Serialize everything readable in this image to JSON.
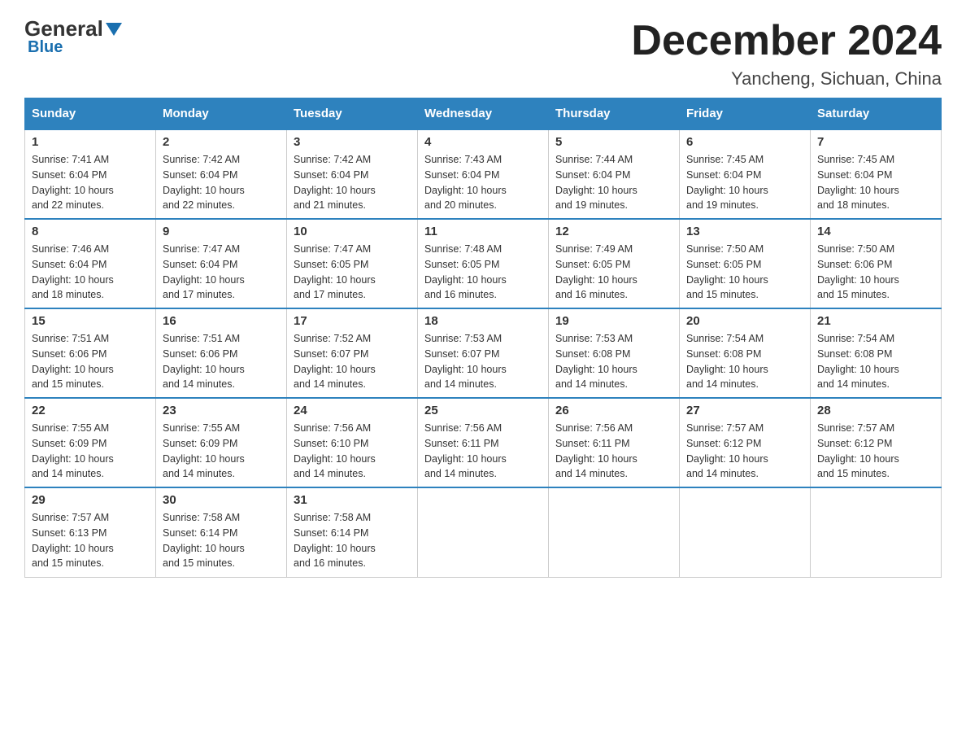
{
  "logo": {
    "general": "General",
    "blue": "Blue"
  },
  "header": {
    "month": "December 2024",
    "location": "Yancheng, Sichuan, China"
  },
  "days_of_week": [
    "Sunday",
    "Monday",
    "Tuesday",
    "Wednesday",
    "Thursday",
    "Friday",
    "Saturday"
  ],
  "weeks": [
    [
      {
        "day": "1",
        "sunrise": "7:41 AM",
        "sunset": "6:04 PM",
        "daylight": "10 hours and 22 minutes."
      },
      {
        "day": "2",
        "sunrise": "7:42 AM",
        "sunset": "6:04 PM",
        "daylight": "10 hours and 22 minutes."
      },
      {
        "day": "3",
        "sunrise": "7:42 AM",
        "sunset": "6:04 PM",
        "daylight": "10 hours and 21 minutes."
      },
      {
        "day": "4",
        "sunrise": "7:43 AM",
        "sunset": "6:04 PM",
        "daylight": "10 hours and 20 minutes."
      },
      {
        "day": "5",
        "sunrise": "7:44 AM",
        "sunset": "6:04 PM",
        "daylight": "10 hours and 19 minutes."
      },
      {
        "day": "6",
        "sunrise": "7:45 AM",
        "sunset": "6:04 PM",
        "daylight": "10 hours and 19 minutes."
      },
      {
        "day": "7",
        "sunrise": "7:45 AM",
        "sunset": "6:04 PM",
        "daylight": "10 hours and 18 minutes."
      }
    ],
    [
      {
        "day": "8",
        "sunrise": "7:46 AM",
        "sunset": "6:04 PM",
        "daylight": "10 hours and 18 minutes."
      },
      {
        "day": "9",
        "sunrise": "7:47 AM",
        "sunset": "6:04 PM",
        "daylight": "10 hours and 17 minutes."
      },
      {
        "day": "10",
        "sunrise": "7:47 AM",
        "sunset": "6:05 PM",
        "daylight": "10 hours and 17 minutes."
      },
      {
        "day": "11",
        "sunrise": "7:48 AM",
        "sunset": "6:05 PM",
        "daylight": "10 hours and 16 minutes."
      },
      {
        "day": "12",
        "sunrise": "7:49 AM",
        "sunset": "6:05 PM",
        "daylight": "10 hours and 16 minutes."
      },
      {
        "day": "13",
        "sunrise": "7:50 AM",
        "sunset": "6:05 PM",
        "daylight": "10 hours and 15 minutes."
      },
      {
        "day": "14",
        "sunrise": "7:50 AM",
        "sunset": "6:06 PM",
        "daylight": "10 hours and 15 minutes."
      }
    ],
    [
      {
        "day": "15",
        "sunrise": "7:51 AM",
        "sunset": "6:06 PM",
        "daylight": "10 hours and 15 minutes."
      },
      {
        "day": "16",
        "sunrise": "7:51 AM",
        "sunset": "6:06 PM",
        "daylight": "10 hours and 14 minutes."
      },
      {
        "day": "17",
        "sunrise": "7:52 AM",
        "sunset": "6:07 PM",
        "daylight": "10 hours and 14 minutes."
      },
      {
        "day": "18",
        "sunrise": "7:53 AM",
        "sunset": "6:07 PM",
        "daylight": "10 hours and 14 minutes."
      },
      {
        "day": "19",
        "sunrise": "7:53 AM",
        "sunset": "6:08 PM",
        "daylight": "10 hours and 14 minutes."
      },
      {
        "day": "20",
        "sunrise": "7:54 AM",
        "sunset": "6:08 PM",
        "daylight": "10 hours and 14 minutes."
      },
      {
        "day": "21",
        "sunrise": "7:54 AM",
        "sunset": "6:08 PM",
        "daylight": "10 hours and 14 minutes."
      }
    ],
    [
      {
        "day": "22",
        "sunrise": "7:55 AM",
        "sunset": "6:09 PM",
        "daylight": "10 hours and 14 minutes."
      },
      {
        "day": "23",
        "sunrise": "7:55 AM",
        "sunset": "6:09 PM",
        "daylight": "10 hours and 14 minutes."
      },
      {
        "day": "24",
        "sunrise": "7:56 AM",
        "sunset": "6:10 PM",
        "daylight": "10 hours and 14 minutes."
      },
      {
        "day": "25",
        "sunrise": "7:56 AM",
        "sunset": "6:11 PM",
        "daylight": "10 hours and 14 minutes."
      },
      {
        "day": "26",
        "sunrise": "7:56 AM",
        "sunset": "6:11 PM",
        "daylight": "10 hours and 14 minutes."
      },
      {
        "day": "27",
        "sunrise": "7:57 AM",
        "sunset": "6:12 PM",
        "daylight": "10 hours and 14 minutes."
      },
      {
        "day": "28",
        "sunrise": "7:57 AM",
        "sunset": "6:12 PM",
        "daylight": "10 hours and 15 minutes."
      }
    ],
    [
      {
        "day": "29",
        "sunrise": "7:57 AM",
        "sunset": "6:13 PM",
        "daylight": "10 hours and 15 minutes."
      },
      {
        "day": "30",
        "sunrise": "7:58 AM",
        "sunset": "6:14 PM",
        "daylight": "10 hours and 15 minutes."
      },
      {
        "day": "31",
        "sunrise": "7:58 AM",
        "sunset": "6:14 PM",
        "daylight": "10 hours and 16 minutes."
      },
      null,
      null,
      null,
      null
    ]
  ],
  "labels": {
    "sunrise": "Sunrise:",
    "sunset": "Sunset:",
    "daylight": "Daylight:"
  }
}
